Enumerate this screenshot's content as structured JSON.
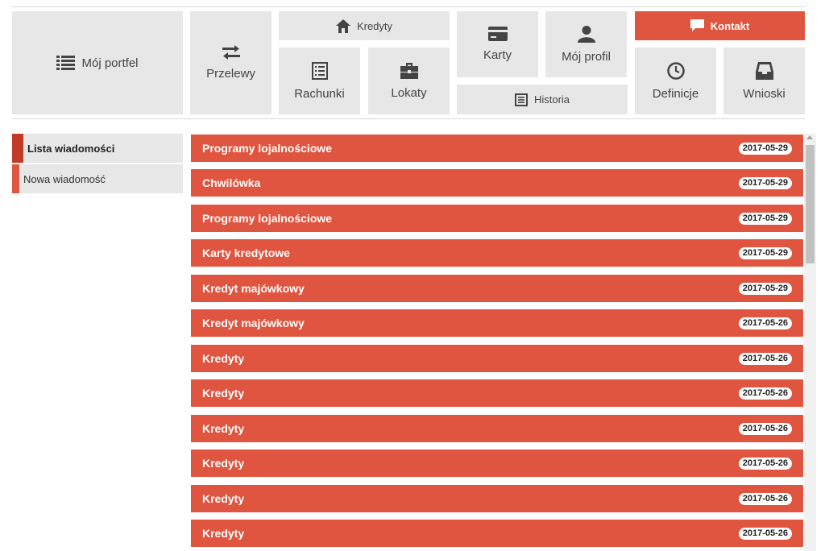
{
  "nav": {
    "moj_portfel": "Mój portfel",
    "przelewy": "Przelewy",
    "kredyty": "Kredyty",
    "rachunki": "Rachunki",
    "lokaty": "Lokaty",
    "karty": "Karty",
    "historia": "Historia",
    "moj_profil": "Mój profil",
    "kontakt": "Kontakt",
    "definicje": "Definicje",
    "wnioski": "Wnioski"
  },
  "sidebar": {
    "items": [
      {
        "label": "Lista wiadomości",
        "active": true
      },
      {
        "label": "Nowa wiadomość",
        "active": false
      }
    ]
  },
  "messages": [
    {
      "subject": "Programy lojalnościowe",
      "date": "2017-05-29"
    },
    {
      "subject": "Chwilówka",
      "date": "2017-05-29"
    },
    {
      "subject": "Programy lojalnościowe",
      "date": "2017-05-29"
    },
    {
      "subject": "Karty kredytowe",
      "date": "2017-05-29"
    },
    {
      "subject": "Kredyt majówkowy",
      "date": "2017-05-29"
    },
    {
      "subject": "Kredyt majówkowy",
      "date": "2017-05-26"
    },
    {
      "subject": "Kredyty",
      "date": "2017-05-26"
    },
    {
      "subject": "Kredyty",
      "date": "2017-05-26"
    },
    {
      "subject": "Kredyty",
      "date": "2017-05-26"
    },
    {
      "subject": "Kredyty",
      "date": "2017-05-26"
    },
    {
      "subject": "Kredyty",
      "date": "2017-05-26"
    },
    {
      "subject": "Kredyty",
      "date": "2017-05-26"
    }
  ],
  "colors": {
    "accent": "#e05540",
    "accent_dark": "#c13b27",
    "tile": "#e7e7e7"
  },
  "icons": {
    "moj_portfel": "list-icon",
    "przelewy": "transfer-arrows-icon",
    "kredyty": "home-icon",
    "rachunki": "receipt-icon",
    "lokaty": "briefcase-icon",
    "karty": "credit-card-icon",
    "historia": "history-list-icon",
    "moj_profil": "user-icon",
    "kontakt": "chat-bubble-icon",
    "definicje": "clock-icon",
    "wnioski": "inbox-icon"
  }
}
